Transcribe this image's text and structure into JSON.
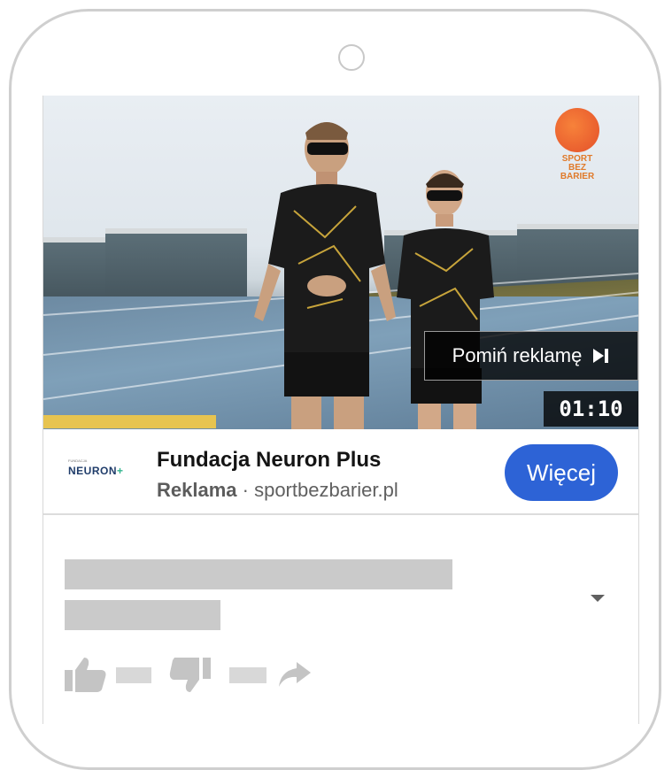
{
  "ad": {
    "skip_label": "Pomiń reklamę",
    "timer": "01:10",
    "progress": 0.29,
    "advertiser_logo_small": "FUNDACJA",
    "advertiser_logo_text": "NEURON",
    "advertiser_logo_plus": "+",
    "title": "Fundacja Neuron Plus",
    "sponsored_label": "Reklama",
    "separator": " · ",
    "domain": "sportbezbarier.pl",
    "cta_label": "Więcej"
  },
  "video_logo": {
    "line1": "SPORT",
    "line2": "BEZ",
    "line3": "BARIER"
  },
  "colors": {
    "accent": "#2d63d6",
    "progress": "#e7c450",
    "placeholder": "#cacaca"
  },
  "icons": [
    "skip-next-icon",
    "thumbs-up-icon",
    "thumbs-down-icon",
    "share-icon",
    "dropdown-arrow-icon"
  ]
}
